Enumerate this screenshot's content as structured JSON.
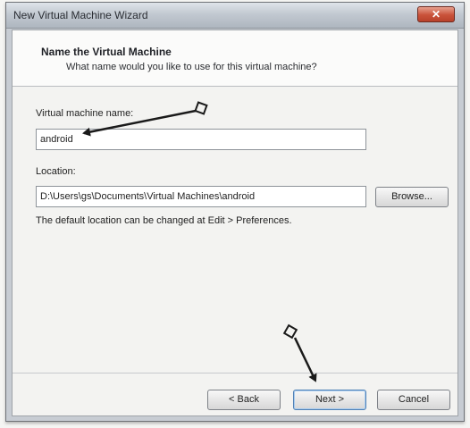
{
  "window": {
    "title": "New Virtual Machine Wizard",
    "close_glyph": "✕"
  },
  "header": {
    "title": "Name the Virtual Machine",
    "subtitle": "What name would you like to use for this virtual machine?"
  },
  "form": {
    "vm_name_label": "Virtual machine name:",
    "vm_name_value": "android",
    "location_label": "Location:",
    "location_value": "D:\\Users\\gs\\Documents\\Virtual Machines\\android",
    "browse_label": "Browse...",
    "hint": "The default location can be changed at Edit > Preferences."
  },
  "footer": {
    "back_label": "< Back",
    "next_label": "Next >",
    "cancel_label": "Cancel"
  },
  "colors": {
    "arrow": "#1a1a1a",
    "default_button_border": "#4f80b5"
  }
}
